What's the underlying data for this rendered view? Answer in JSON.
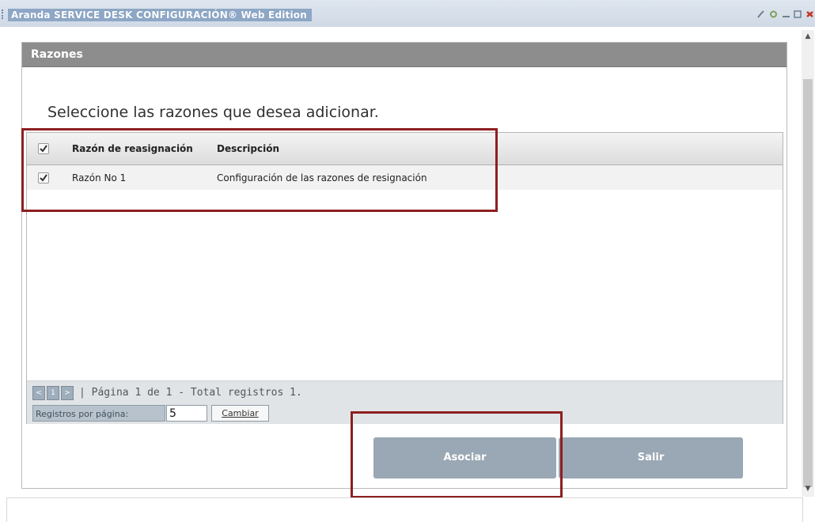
{
  "window": {
    "title": "Aranda SERVICE DESK CONFIGURACIÓN® Web Edition"
  },
  "dialog": {
    "title": "Razones",
    "instruction": "Seleccione las razones que desea adicionar."
  },
  "grid": {
    "columns": [
      "Razón de reasignación",
      "Descripción"
    ],
    "select_all_checked": true,
    "rows": [
      {
        "checked": true,
        "razon": "Razón No 1",
        "descripcion": "Configuración de las razones de resignación"
      }
    ]
  },
  "pager": {
    "prev": "<",
    "page": "1",
    "next": ">",
    "status": "| Página 1 de 1 - Total registros 1.",
    "records_label": "Registros por página:",
    "records_value": "5",
    "change_label": "Cambiar"
  },
  "buttons": {
    "associate": "Asociar",
    "exit": "Salir"
  },
  "colors": {
    "highlight": "#8d1f20",
    "header_bar": "#8d8d8d",
    "button": "#9aa7b4"
  }
}
